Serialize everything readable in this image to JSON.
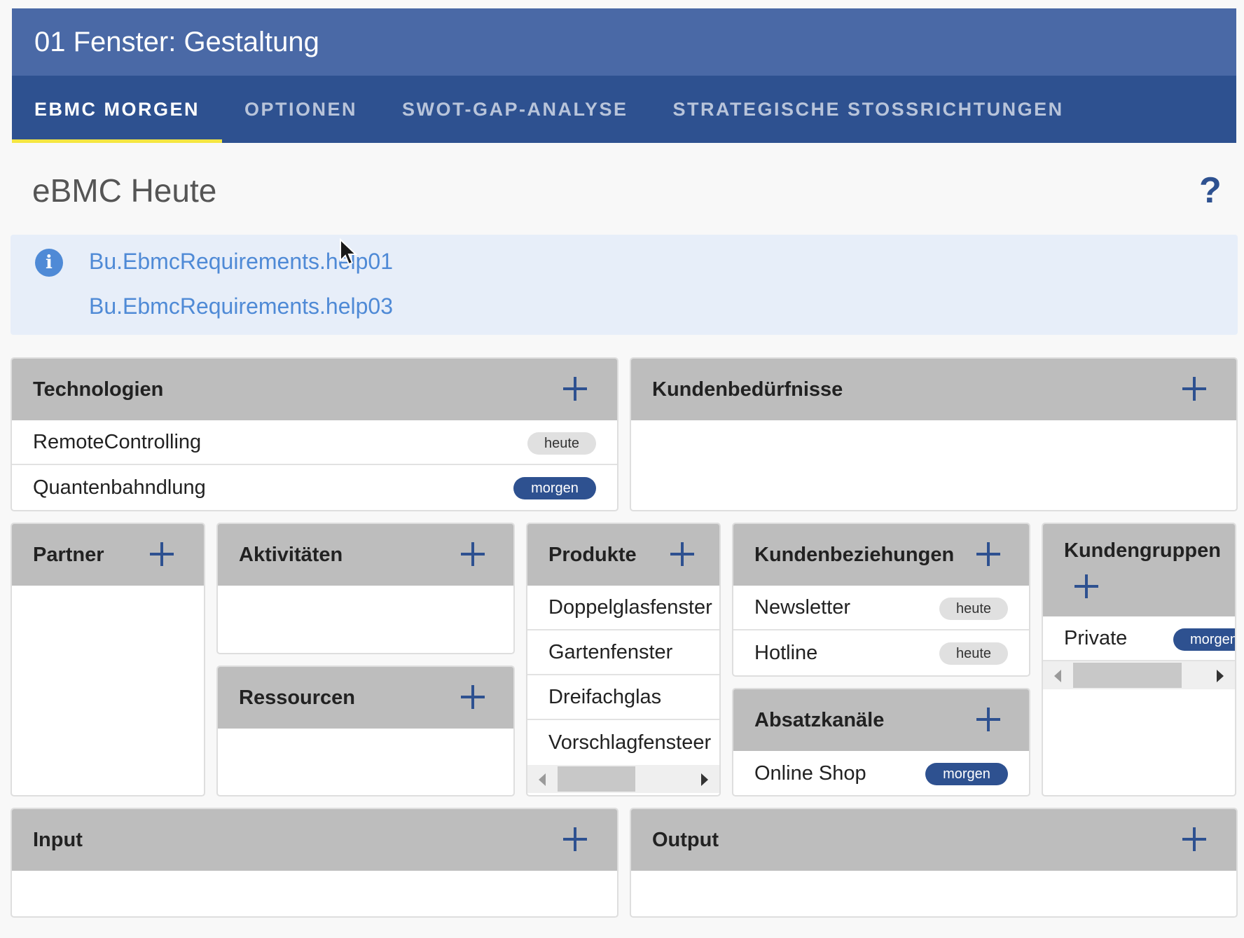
{
  "window": {
    "title": "01 Fenster: Gestaltung"
  },
  "tabs": [
    {
      "label": "EBMC MORGEN",
      "active": true
    },
    {
      "label": "OPTIONEN",
      "active": false
    },
    {
      "label": "SWOT-GAP-ANALYSE",
      "active": false
    },
    {
      "label": "STRATEGISCHE STOSSRICHTUNGEN",
      "active": false
    }
  ],
  "page": {
    "title": "eBMC Heute",
    "help_glyph": "?"
  },
  "info": {
    "icon": "info-icon",
    "icon_glyph": "i",
    "links": [
      "Bu.EbmcRequirements.help01",
      "Bu.EbmcRequirements.help03"
    ]
  },
  "cards": {
    "technologien": {
      "title": "Technologien",
      "items": [
        {
          "label": "RemoteControlling",
          "badge": "heute"
        },
        {
          "label": "Quantenbahndlung",
          "badge": "morgen"
        }
      ]
    },
    "kundenbeduerfnisse": {
      "title": "Kundenbedürfnisse"
    },
    "partner": {
      "title": "Partner"
    },
    "aktivitaeten": {
      "title": "Aktivitäten"
    },
    "ressourcen": {
      "title": "Ressourcen"
    },
    "produkte": {
      "title": "Produkte",
      "items": [
        {
          "label": "Doppelglasfenster"
        },
        {
          "label": "Gartenfenster"
        },
        {
          "label": "Dreifachglas"
        },
        {
          "label": "Vorschlagfensteer"
        }
      ]
    },
    "kundenbeziehungen": {
      "title": "Kundenbeziehungen",
      "items": [
        {
          "label": "Newsletter",
          "badge": "heute"
        },
        {
          "label": "Hotline",
          "badge": "heute"
        }
      ]
    },
    "absatzkanaele": {
      "title": "Absatzkanäle",
      "items": [
        {
          "label": "Online Shop",
          "badge": "morgen"
        }
      ]
    },
    "kundengruppen": {
      "title": "Kundengruppen",
      "items": [
        {
          "label": "Private",
          "badge": "morgen"
        }
      ]
    },
    "input": {
      "title": "Input"
    },
    "output": {
      "title": "Output"
    }
  },
  "colors": {
    "header_bg": "#4a69a6",
    "tabbar_bg": "#2e5190",
    "tab_indicator": "#f5e642",
    "card_header_bg": "#bdbdbd",
    "accent": "#2e5190",
    "info_bg": "#e7eef9",
    "link": "#4f8ad6"
  }
}
